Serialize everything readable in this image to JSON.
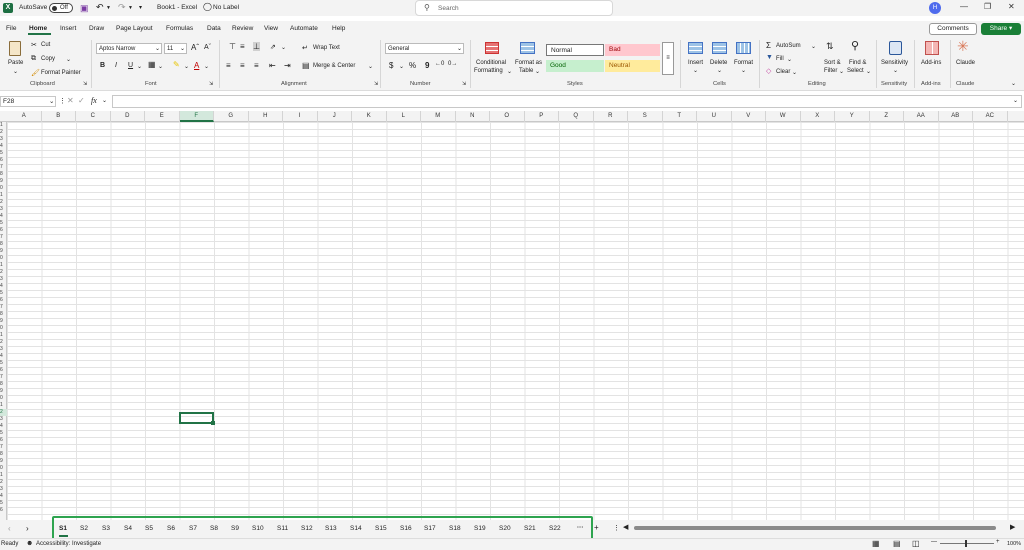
{
  "titlebar": {
    "autosave": "AutoSave",
    "toggle": "Off",
    "doc_title": "Book1 - Excel",
    "label": "No Label",
    "search_placeholder": "Search",
    "avatar": "H"
  },
  "menu": {
    "items": [
      "File",
      "Home",
      "Insert",
      "Draw",
      "Page Layout",
      "Formulas",
      "Data",
      "Review",
      "View",
      "Automate",
      "Help"
    ],
    "comments": "Comments",
    "share": "Share"
  },
  "ribbon": {
    "clipboard": {
      "paste": "Paste",
      "cut": "Cut",
      "copy": "Copy",
      "format_painter": "Format Painter",
      "group": "Clipboard"
    },
    "font": {
      "name": "Aptos Narrow",
      "size": "11",
      "bold": "B",
      "italic": "I",
      "underline": "U",
      "group": "Font"
    },
    "alignment": {
      "wrap": "Wrap Text",
      "merge": "Merge & Center",
      "group": "Alignment"
    },
    "number": {
      "format": "General",
      "currency": "$",
      "percent": "%",
      "comma": "9",
      "group": "Number"
    },
    "styles": {
      "conditional": "Conditional",
      "conditional2": "Formatting",
      "format_as": "Format as",
      "table": "Table",
      "normal": "Normal",
      "bad": "Bad",
      "good": "Good",
      "neutral": "Neutral",
      "group": "Styles"
    },
    "cells": {
      "insert": "Insert",
      "delete": "Delete",
      "format": "Format",
      "group": "Cells"
    },
    "editing": {
      "autosum": "AutoSum",
      "fill": "Fill",
      "clear": "Clear",
      "sort": "Sort &",
      "filter": "Filter",
      "find": "Find &",
      "select": "Select",
      "group": "Editing"
    },
    "sensitivity": {
      "label": "Sensitivity",
      "group": "Sensitivity"
    },
    "addins": {
      "label": "Add-ins",
      "group": "Add-ins"
    },
    "claude": {
      "label": "Claude",
      "group": "Claude"
    },
    "colors": {
      "accent": "#217346",
      "bad_bg": "#ffc7ce",
      "bad_fg": "#9c0006",
      "good_bg": "#c6efce",
      "good_fg": "#006100",
      "neutral_bg": "#ffeb9c",
      "neutral_fg": "#9c5700",
      "highlight": "#2ea44f"
    }
  },
  "formula_bar": {
    "name_box": "F28",
    "fx": "fx"
  },
  "grid": {
    "columns": [
      "A",
      "B",
      "C",
      "D",
      "E",
      "F",
      "G",
      "H",
      "I",
      "J",
      "K",
      "L",
      "M",
      "N",
      "O",
      "P",
      "Q",
      "R",
      "S",
      "T",
      "U",
      "V",
      "W",
      "X",
      "Y",
      "Z",
      "AA",
      "AB",
      "AC"
    ],
    "rows": [
      "1",
      "2",
      "3",
      "4",
      "5",
      "6",
      "7",
      "8",
      "9",
      "0",
      "1",
      "2",
      "3",
      "4",
      "5",
      "6",
      "7",
      "8",
      "9",
      "0",
      "1",
      "2",
      "3",
      "4",
      "5",
      "6",
      "7",
      "8",
      "9",
      "0",
      "1",
      "2",
      "3",
      "4",
      "5",
      "6",
      "7",
      "8",
      "9",
      "0",
      "1",
      "2",
      "3",
      "4",
      "5",
      "6",
      "7",
      "8",
      "9",
      "0",
      "1",
      "2",
      "3",
      "4",
      "5",
      "6"
    ]
  },
  "sheets": {
    "tabs": [
      "S1",
      "S2",
      "S3",
      "S4",
      "S5",
      "S6",
      "S7",
      "S8",
      "S9",
      "S10",
      "S11",
      "S12",
      "S13",
      "S14",
      "S15",
      "S16",
      "S17",
      "S18",
      "S19",
      "S20",
      "S21",
      "S22"
    ],
    "more": "···",
    "add": "+"
  },
  "status": {
    "ready": "Ready",
    "accessibility": "Accessibility: Investigate",
    "zoom": "100%"
  }
}
